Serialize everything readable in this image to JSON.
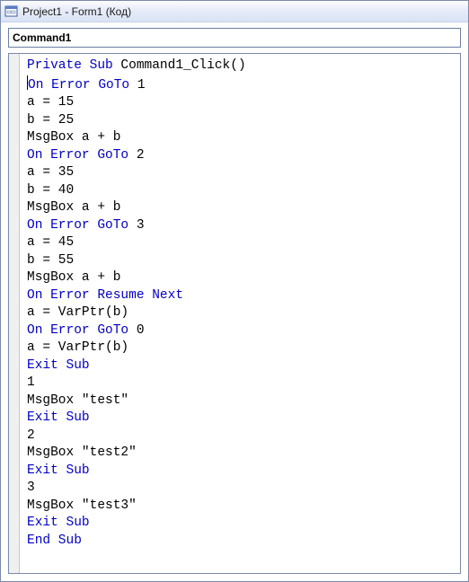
{
  "window": {
    "title": "Project1 - Form1 (Код)"
  },
  "dropdown": {
    "selected": "Command1"
  },
  "code": {
    "lines": [
      [
        {
          "t": "Private Sub",
          "kw": true
        },
        {
          "t": " Command1_Click()",
          "kw": false
        }
      ],
      [
        {
          "t": "|",
          "cursor": true
        },
        {
          "t": "On Error GoTo",
          "kw": true
        },
        {
          "t": " 1",
          "kw": false
        }
      ],
      [
        {
          "t": "a = 15",
          "kw": false
        }
      ],
      [
        {
          "t": "b = 25",
          "kw": false
        }
      ],
      [
        {
          "t": "MsgBox a + b",
          "kw": false
        }
      ],
      [
        {
          "t": "On Error GoTo",
          "kw": true
        },
        {
          "t": " 2",
          "kw": false
        }
      ],
      [
        {
          "t": "a = 35",
          "kw": false
        }
      ],
      [
        {
          "t": "b = 40",
          "kw": false
        }
      ],
      [
        {
          "t": "MsgBox a + b",
          "kw": false
        }
      ],
      [
        {
          "t": "On Error GoTo",
          "kw": true
        },
        {
          "t": " 3",
          "kw": false
        }
      ],
      [
        {
          "t": "a = 45",
          "kw": false
        }
      ],
      [
        {
          "t": "b = 55",
          "kw": false
        }
      ],
      [
        {
          "t": "MsgBox a + b",
          "kw": false
        }
      ],
      [
        {
          "t": "On Error Resume Next",
          "kw": true
        }
      ],
      [
        {
          "t": "a = VarPtr(b)",
          "kw": false
        }
      ],
      [
        {
          "t": "On Error GoTo",
          "kw": true
        },
        {
          "t": " 0",
          "kw": false
        }
      ],
      [
        {
          "t": "a = VarPtr(b)",
          "kw": false
        }
      ],
      [
        {
          "t": "Exit Sub",
          "kw": true
        }
      ],
      [
        {
          "t": "1",
          "kw": false
        }
      ],
      [
        {
          "t": "MsgBox \"test\"",
          "kw": false
        }
      ],
      [
        {
          "t": "Exit Sub",
          "kw": true
        }
      ],
      [
        {
          "t": "2",
          "kw": false
        }
      ],
      [
        {
          "t": "MsgBox \"test2\"",
          "kw": false
        }
      ],
      [
        {
          "t": "Exit Sub",
          "kw": true
        }
      ],
      [
        {
          "t": "3",
          "kw": false
        }
      ],
      [
        {
          "t": "MsgBox \"test3\"",
          "kw": false
        }
      ],
      [
        {
          "t": "Exit Sub",
          "kw": true
        }
      ],
      [
        {
          "t": "End Sub",
          "kw": true
        }
      ]
    ]
  }
}
